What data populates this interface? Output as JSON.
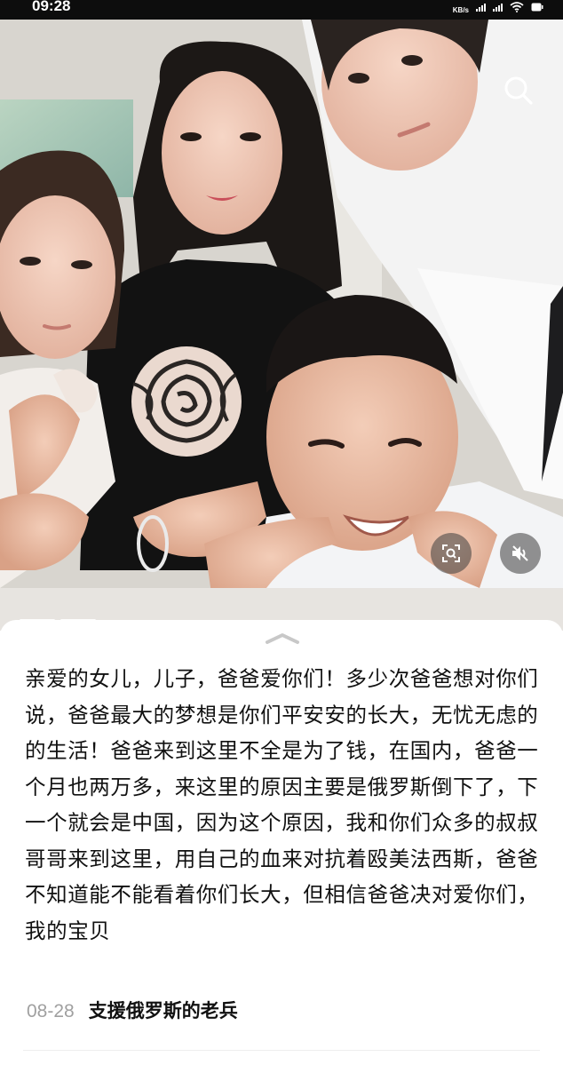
{
  "status_bar": {
    "time": "09:28",
    "net_speed_unit": "KB/s",
    "background": "#0d0d0d"
  },
  "photo": {
    "description_icons": [
      "search-icon",
      "scan-icon",
      "mute-icon"
    ],
    "progress": {
      "segments_total": 2,
      "active": 1
    }
  },
  "post": {
    "caption": "亲爱的女儿，儿子，爸爸爱你们！多少次爸爸想对你们说，爸爸最大的梦想是你们平安安的长大，无忧无虑的的生活！爸爸来到这里不全是为了钱，在国内，爸爸一个月也两万多，来这里的原因主要是俄罗斯倒下了，下一个就会是中国，因为这个原因，我和你们众多的叔叔哥哥来到这里，用自己的血来对抗着殴美法西斯，爸爸不知道能不能看着你们长大，但相信爸爸决对爱你们，我的宝贝",
    "date": "08-28",
    "author": "支援俄罗斯的老兵"
  },
  "colors": {
    "text": "#111111",
    "meta_gray": "#a0a0a0",
    "panel_bg": "#ffffff"
  }
}
